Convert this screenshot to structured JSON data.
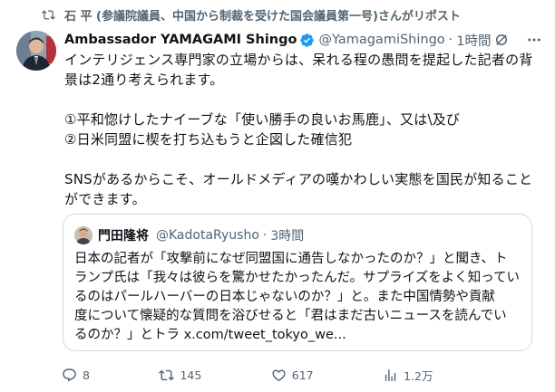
{
  "repost": {
    "icon": "repost-icon",
    "text": "石 平 (参議院議員、中国から制裁を受けた国会議員第一号)さんがリポスト"
  },
  "tweet": {
    "author_name": "Ambassador YAMAGAMI Shingo",
    "handle": "@YamagamiShingo",
    "separator": "·",
    "time": "1時間",
    "lines": [
      "インテリジェンス専門家の立場からは、呆れる程の愚問を提起した記者の背",
      "景は2通り考えられます。",
      "①平和惚けしたナイーブな「使い勝手の良いお馬鹿」、又は\\及び",
      "②日米同盟に楔を打ち込もうと企図した確信犯",
      "SNSがあるからこそ、オールドメディアの嘆かわしい実態を国民が知ること",
      "ができます。"
    ]
  },
  "quote": {
    "author_name": "門田隆将",
    "handle": "@KadotaRyusho",
    "separator": "·",
    "time": "3時間",
    "lines": [
      "日本の記者が「攻撃前になぜ同盟国に通告しなかったのか？」と聞き、ト",
      "ランプ氏は「我々は彼らを驚かせたかったんだ。サプライズをよく知ってい",
      "るのはパールハーバーの日本じゃないのか？」と。また中国情勢や貢献",
      "度について懐疑的な質問を浴びせると「君はまだ古いニュースを読んでい",
      "るのか？」とトラ x.com/tweet_tokyo_we..."
    ]
  },
  "actions": {
    "reply_count": "8",
    "repost_count": "145",
    "like_count": "617",
    "views_count": "1.2万"
  },
  "colors": {
    "text": "#0f1419",
    "secondary": "#536471",
    "verified": "#1d9bf0",
    "border": "#cfd9de"
  }
}
